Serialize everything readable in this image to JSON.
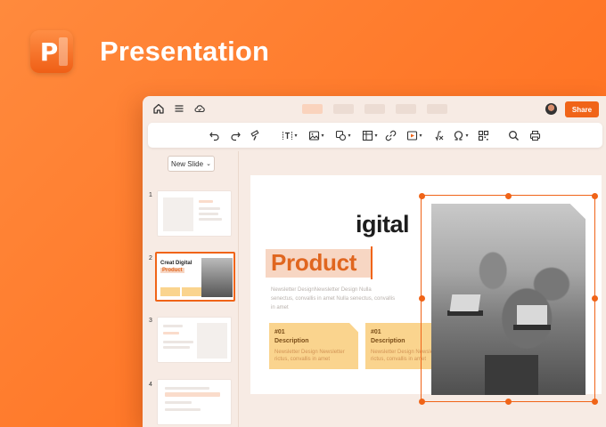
{
  "app": {
    "title": "Presentation",
    "icon_letter": "P",
    "icon": "presentation-app-icon"
  },
  "colors": {
    "accent": "#f06418",
    "background": "#ff7b2c",
    "window": "#f7ebe4",
    "card": "#fad48e"
  },
  "topbar": {
    "icons": [
      "home-icon",
      "menu-icon",
      "cloud-icon"
    ],
    "tabs_count": 5,
    "share_label": "Share"
  },
  "toolbar": {
    "tools": [
      "undo-icon",
      "redo-icon",
      "format-painter-icon",
      "text-box-icon",
      "image-icon",
      "shape-icon",
      "table-icon",
      "link-icon",
      "media-icon",
      "formula-icon",
      "symbol-icon",
      "qr-code-icon",
      "search-icon",
      "print-icon"
    ]
  },
  "sidebar": {
    "new_slide_label": "New Slide",
    "thumbnails": [
      {
        "number": "1"
      },
      {
        "number": "2",
        "title_line1": "Creat Digital",
        "title_line2": "Product"
      },
      {
        "number": "3"
      },
      {
        "number": "4"
      }
    ]
  },
  "slide": {
    "title_partial": "igital",
    "highlight_word": "Product",
    "body": "Newsletter DesignNewsletter Design Nulla senectus, convallis in amet Nulla senectus, convallis in amet",
    "cards": [
      {
        "tag": "#01",
        "title": "Description",
        "text": "Newsletter Design Newsletter rictus, convallis in amet"
      },
      {
        "tag": "#01",
        "title": "Description",
        "text": "Newsletter Design Newsletter rictus, convallis in amet"
      }
    ]
  }
}
